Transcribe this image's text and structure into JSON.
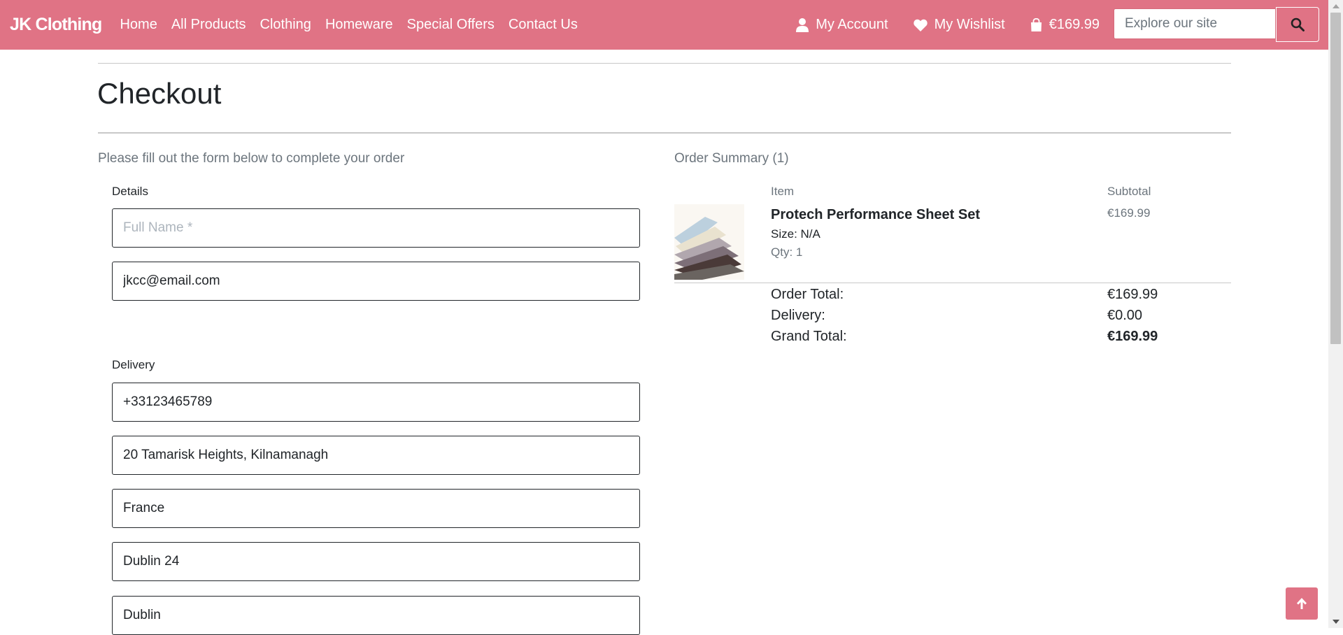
{
  "navbar": {
    "brand": "JK Clothing",
    "links": [
      "Home",
      "All Products",
      "Clothing",
      "Homeware",
      "Special Offers",
      "Contact Us"
    ],
    "account_label": "My Account",
    "wishlist_label": "My Wishlist",
    "bag_total": "€169.99",
    "search_placeholder": "Explore our site",
    "accent_color": "#e07385"
  },
  "page": {
    "title": "Checkout",
    "intro": "Please fill out the form below to complete your order"
  },
  "form": {
    "details_legend": "Details",
    "full_name_placeholder": "Full Name *",
    "full_name_value": "",
    "email_value": "jkcc@email.com",
    "delivery_legend": "Delivery",
    "phone_value": "+33123465789",
    "street_value": "20 Tamarisk Heights, Kilnamanagh",
    "country_value": "France",
    "postcode_value": "Dublin 24",
    "town_value": "Dublin"
  },
  "summary": {
    "title": "Order Summary (1)",
    "col_item": "Item",
    "col_subtotal": "Subtotal",
    "item": {
      "name": "Protech Performance Sheet Set",
      "size": "Size: N/A",
      "qty": "Qty: 1",
      "subtotal": "€169.99"
    },
    "order_total_label": "Order Total:",
    "order_total": "€169.99",
    "delivery_label": "Delivery:",
    "delivery": "€0.00",
    "grand_total_label": "Grand Total:",
    "grand_total": "€169.99"
  },
  "icons": {
    "account": "user-icon",
    "wishlist": "heart-icon",
    "bag": "shopping-bag-icon",
    "search": "search-icon",
    "back_to_top": "arrow-up-icon"
  }
}
